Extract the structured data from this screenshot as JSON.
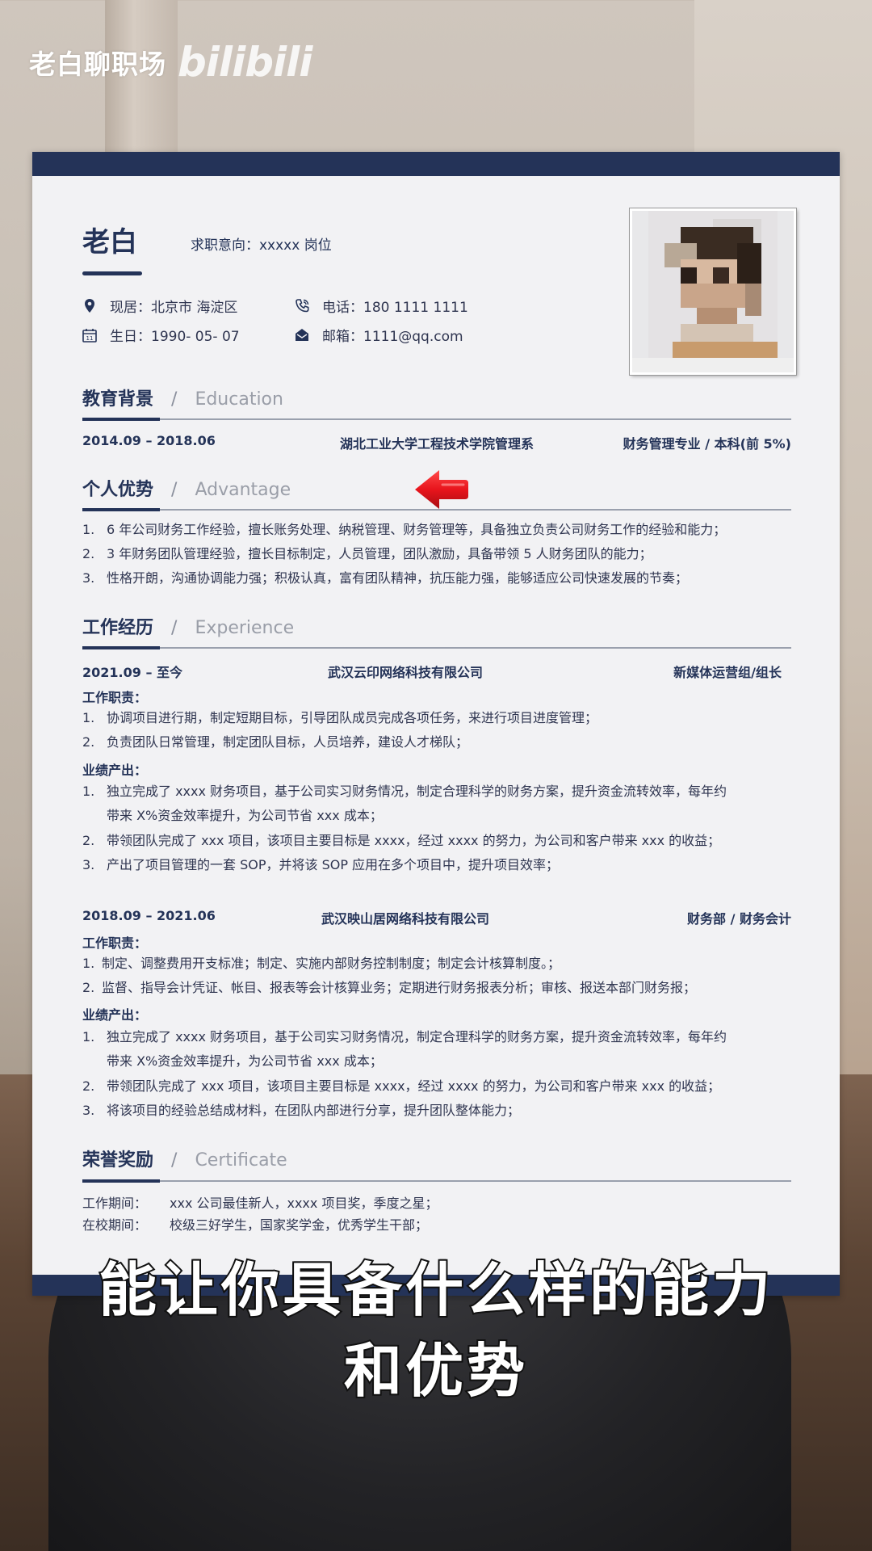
{
  "watermark": {
    "channel": "老白聊职场",
    "logo": "bilibili"
  },
  "resume": {
    "name": "老白",
    "objective": "求职意向：xxxxx 岗位",
    "info": {
      "residence": "现居：北京市 海淀区",
      "phone": "电话：180 1111 1111",
      "birth": "生日：1990- 05- 07",
      "email": "邮箱：1111@qq.com"
    },
    "education": {
      "title_cn": "教育背景",
      "slash": "/",
      "title_en": "Education",
      "period": "2014.09  –  2018.06",
      "school": "湖北工业大学工程技术学院管理系",
      "major": "财务管理专业  /  本科(前 5%)"
    },
    "advantage": {
      "title_cn": "个人优势",
      "slash": "/",
      "title_en": "Advantage",
      "items": [
        {
          "n": "1.",
          "text": "6 年公司财务工作经验，擅长账务处理、纳税管理、财务管理等，具备独立负责公司财务工作的经验和能力；"
        },
        {
          "n": "2.",
          "text": "3 年财务团队管理经验，擅长目标制定，人员管理，团队激励，具备带领 5 人财务团队的能力；"
        },
        {
          "n": "3.",
          "text": "性格开朗，沟通协调能力强；积极认真，富有团队精神，抗压能力强，能够适应公司快速发展的节奏；"
        }
      ]
    },
    "experience": {
      "title_cn": "工作经历",
      "slash": "/",
      "title_en": "Experience",
      "job1": {
        "period": "2021.09 –  至今",
        "company": "武汉云印网络科技有限公司",
        "role": "新媒体运营组/组长",
        "duty_label": "工作职责：",
        "duties": [
          {
            "n": "1.",
            "text": "协调项目进行期，制定短期目标，引导团队成员完成各项任务，来进行项目进度管理；"
          },
          {
            "n": "2.",
            "text": "负责团队日常管理，制定团队目标，人员培养，建设人才梯队；"
          }
        ],
        "result_label": "业绩产出：",
        "results": [
          {
            "n": "1.",
            "text": "独立完成了 xxxx 财务项目，基于公司实习财务情况，制定合理科学的财务方案，提升资金流转效率，每年约"
          },
          {
            "n": "",
            "text": "带来 X%资金效率提升，为公司节省 xxx 成本；"
          },
          {
            "n": "2.",
            "text": "带领团队完成了 xxx 项目，该项目主要目标是 xxxx，经过 xxxx 的努力，为公司和客户带来 xxx 的收益；"
          },
          {
            "n": "3.",
            "text": "产出了项目管理的一套 SOP，并将该 SOP 应用在多个项目中，提升项目效率；"
          }
        ]
      },
      "job2": {
        "period": "2018.09  –  2021.06",
        "company": "武汉映山居网络科技有限公司",
        "role": "财务部  /  财务会计",
        "duty_label": "工作职责：",
        "duties": [
          {
            "n": "1.",
            "text": "制定、调整费用开支标准；制定、实施内部财务控制制度；制定会计核算制度。；"
          },
          {
            "n": "2.",
            "text": "监督、指导会计凭证、帐目、报表等会计核算业务；定期进行财务报表分析；审核、报送本部门财务报；"
          }
        ],
        "result_label": "业绩产出：",
        "results": [
          {
            "n": "1.",
            "text": "独立完成了 xxxx 财务项目，基于公司实习财务情况，制定合理科学的财务方案，提升资金流转效率，每年约"
          },
          {
            "n": "",
            "text": "带来 X%资金效率提升，为公司节省 xxx 成本；"
          },
          {
            "n": "2.",
            "text": "带领团队完成了 xxx 项目，该项目主要目标是 xxxx，经过 xxxx 的努力，为公司和客户带来 xxx 的收益；"
          },
          {
            "n": "3.",
            "text": "将该项目的经验总结成材料，在团队内部进行分享，提升团队整体能力；"
          }
        ]
      }
    },
    "certificate": {
      "title_cn": "荣誉奖励",
      "slash": "/",
      "title_en": "Certificate",
      "items": [
        {
          "label": "工作期间：",
          "text": "xxx 公司最佳新人，xxxx 项目奖，季度之星；"
        },
        {
          "label": "在校期间：",
          "text": "校级三好学生，国家奖学金，优秀学生干部；"
        }
      ]
    }
  },
  "subtitle": {
    "line1": "能让你具备什么样的能力",
    "line2": "和优势"
  },
  "colors": {
    "navy": "#243358",
    "arrow": "#e8141c"
  }
}
